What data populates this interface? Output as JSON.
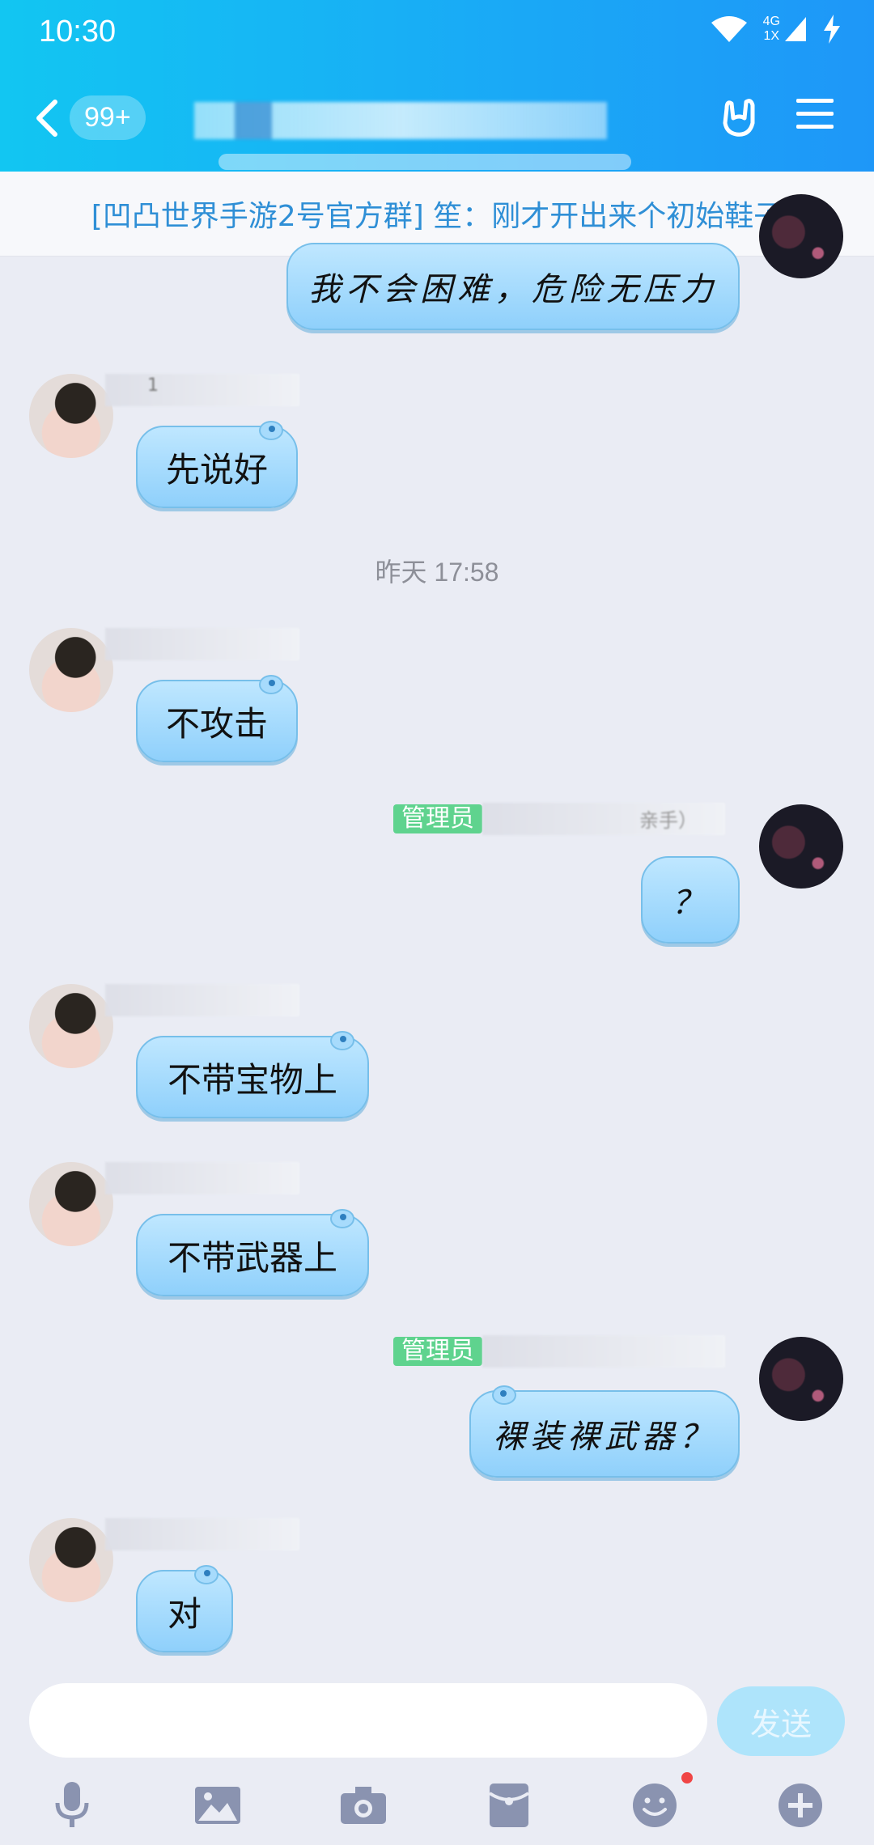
{
  "status_bar": {
    "time": "10:30",
    "network_top": "4G",
    "network_bottom": "1X"
  },
  "header": {
    "unread_badge": "99+"
  },
  "notice": {
    "text": "[凹凸世界手游2号官方群] 笙：刚才开出来个初始鞋子"
  },
  "messages": [
    {
      "side": "right",
      "text": "我不会困难，危险无压力"
    },
    {
      "side": "left",
      "text": "先说好",
      "name_partial": "1"
    },
    {
      "type": "time",
      "text": "昨天 17:58"
    },
    {
      "side": "left",
      "text": "不攻击"
    },
    {
      "side": "right",
      "text": "？",
      "admin_tag": "管理员",
      "name_partial": "亲手）"
    },
    {
      "side": "left",
      "text": "不带宝物上"
    },
    {
      "side": "left",
      "text": "不带武器上"
    },
    {
      "side": "right",
      "text": "裸装裸武器？",
      "admin_tag": "管理员"
    },
    {
      "side": "left",
      "text": "对"
    }
  ],
  "input": {
    "value": "",
    "send_label": "发送"
  },
  "toolbar": {
    "icons": [
      "mic-icon",
      "image-icon",
      "camera-icon",
      "red-packet-icon",
      "emoji-icon",
      "plus-icon"
    ]
  },
  "colors": {
    "header_start": "#12c6f2",
    "header_end": "#1e97f8",
    "bubble": "#9ed7fb",
    "admin_tag": "#5fd38e",
    "notice_text": "#2f8fd6"
  }
}
